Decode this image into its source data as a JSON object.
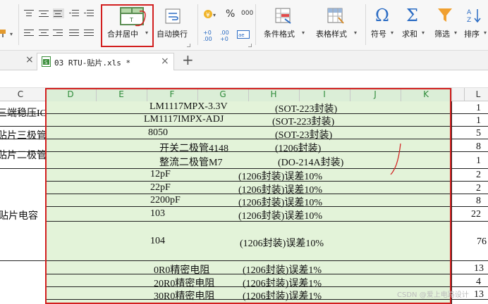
{
  "ribbon": {
    "merge_center_label": "合并居中",
    "wrap_text_label": "自动换行",
    "percent_symbol": "%",
    "thousands_symbol": "000",
    "dec_inc_label": "+0 .00",
    "dec_dec_label": ".00 +0",
    "conditional_format_label": "条件格式",
    "table_style_label": "表格样式",
    "symbol_label": "符号",
    "sum_label": "求和",
    "filter_label": "筛选",
    "sort_label": "排序",
    "symbol_glyph": "Ω",
    "sum_glyph": "Σ"
  },
  "tabbar": {
    "tab_title": "03 RTU-贴片.xls *",
    "new_tab_symbol": "+",
    "close_symbol": "×"
  },
  "columns": {
    "C": "C",
    "D": "D",
    "E": "E",
    "F": "F",
    "G": "G",
    "H": "H",
    "I": "I",
    "J": "J",
    "K": "K",
    "L": "L"
  },
  "rows": [
    {
      "c": "三端稳压IC",
      "name": "LM1117MPX-3.3V",
      "pkg": "(SOT-223封装)",
      "l": "1"
    },
    {
      "c": "",
      "name": "LM1117IMPX-ADJ",
      "pkg": "(SOT-223封装)",
      "l": "1"
    },
    {
      "c": "贴片三极管",
      "name": "8050",
      "pkg": "(SOT-23封装)",
      "l": "5"
    },
    {
      "c": "贴片二极管",
      "name": "开关二极管4148",
      "pkg": "(1206封装)",
      "l": "8"
    },
    {
      "c": "",
      "name": "整流二极管M7",
      "pkg": "(DO-214A封装)",
      "l": "1"
    },
    {
      "c": "",
      "name": "12pF",
      "pkg": "(1206封装)误差10%",
      "l": "2"
    },
    {
      "c": "",
      "name": "22pF",
      "pkg": "(1206封装)误差10%",
      "l": "2"
    },
    {
      "c": "",
      "name": "2200pF",
      "pkg": "(1206封装)误差10%",
      "l": "8"
    },
    {
      "c": "",
      "name": "103",
      "pkg": "(1206封装)误差10%",
      "l": "22"
    },
    {
      "c": "贴片电容",
      "name": "104",
      "pkg": "(1206封装)误差10%",
      "l": "76"
    },
    {
      "c": "",
      "name": "0R0精密电阻",
      "pkg": "(1206封装)误差1%",
      "l": "13"
    },
    {
      "c": "",
      "name": "20R0精密电阻",
      "pkg": "(1206封装)误差1%",
      "l": "4"
    },
    {
      "c": "",
      "name": "30R0精密电阻",
      "pkg": "(1206封装)误差1%",
      "l": "13"
    }
  ],
  "watermark": "CSDN @爱上电路设计",
  "colors": {
    "selection_fill": "#e3f3d9",
    "selection_header": "#dbeed7",
    "highlight_red": "#d21f1f",
    "green_header_text": "#2e8b3a"
  }
}
